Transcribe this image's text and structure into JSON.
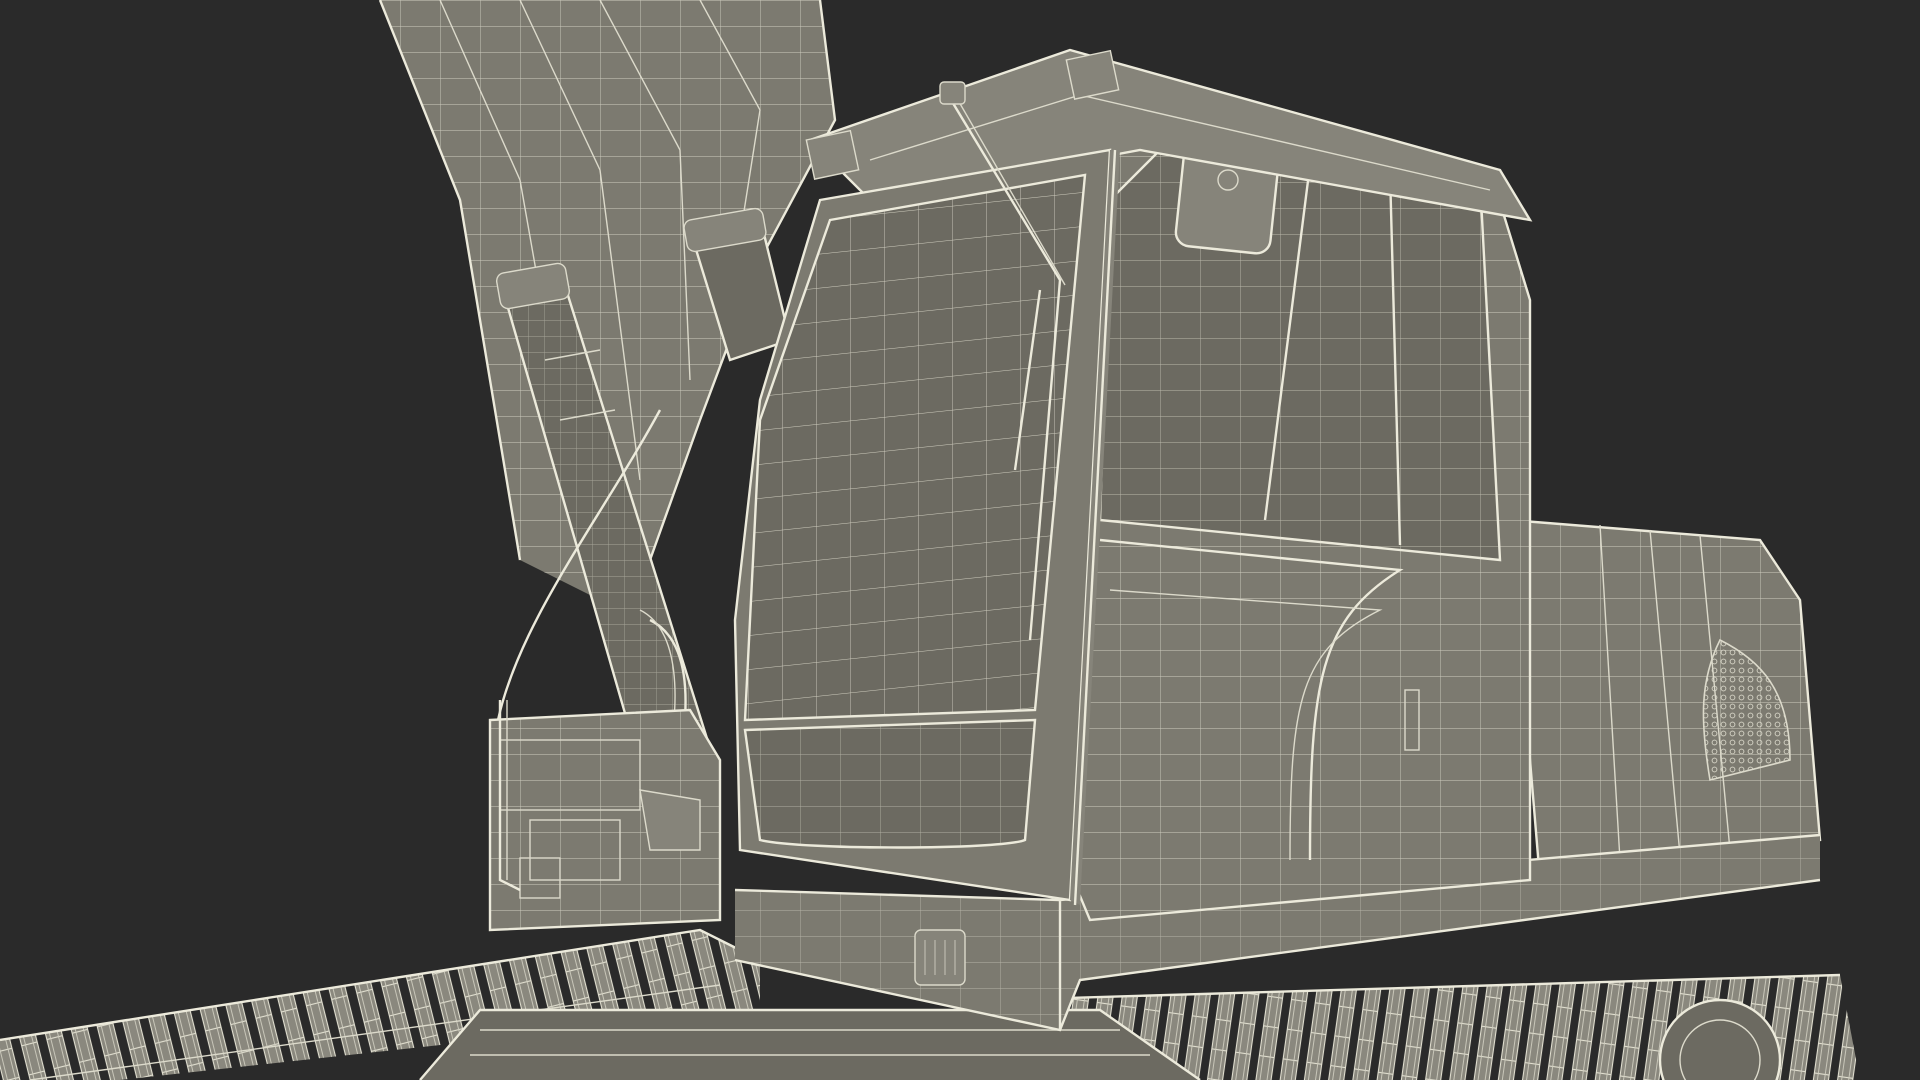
{
  "scene": {
    "subject": "excavator-wireframe-render",
    "colors": {
      "background": "#2a2a2a",
      "body": "#7c7a70",
      "body_dark": "#6c6a61",
      "wire": "#dcdacb"
    }
  }
}
